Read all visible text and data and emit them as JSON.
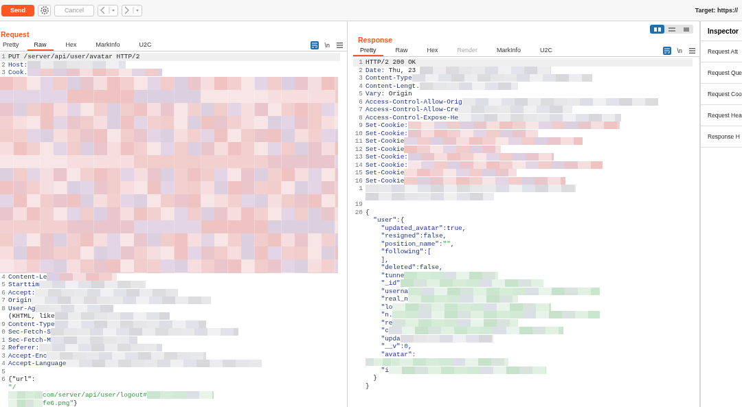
{
  "toolbar": {
    "send": "Send",
    "cancel": "Cancel",
    "cancel_disabled": true,
    "target": "Target: https://"
  },
  "request": {
    "title": "Request",
    "tabs": [
      {
        "label": "Pretty",
        "selected": false,
        "disabled": false
      },
      {
        "label": "Raw",
        "selected": true,
        "disabled": false
      },
      {
        "label": "Hex",
        "selected": false,
        "disabled": false
      },
      {
        "label": "MarkInfo",
        "selected": false,
        "disabled": false
      },
      {
        "label": "U2C",
        "selected": false,
        "disabled": false
      }
    ],
    "newline_toggle": "\\n",
    "lines": [
      {
        "kind": "code",
        "num": "1",
        "current": true,
        "segs": [
          {
            "kind": "plain",
            "text": "PUT /server/api/user/avatar HTTP/2"
          }
        ]
      },
      {
        "kind": "code",
        "num": "2",
        "current": false,
        "mosaic": {
          "kind": "grey"
        },
        "segs": [
          {
            "kind": "key",
            "text": "Host:"
          }
        ]
      },
      {
        "kind": "code",
        "num": "3",
        "current": false,
        "mosaic": {
          "kind": "pink"
        },
        "segs": [
          {
            "kind": "key",
            "text": "Cook."
          }
        ]
      },
      {
        "kind": "block",
        "mosaic": {
          "kind": "pink"
        }
      },
      {
        "kind": "code",
        "num": "4",
        "current": false,
        "mosaic": {
          "kind": "pink"
        },
        "segs": [
          {
            "kind": "key",
            "text": "Content-Le"
          }
        ]
      },
      {
        "kind": "code",
        "num": "5",
        "current": false,
        "mosaic": {
          "kind": "grey"
        },
        "segs": [
          {
            "kind": "key",
            "text": "Starttim"
          }
        ]
      },
      {
        "kind": "code",
        "num": "6",
        "current": false,
        "mosaic": {
          "kind": "grey"
        },
        "segs": [
          {
            "kind": "key",
            "text": "Accept:"
          }
        ]
      },
      {
        "kind": "code",
        "num": "7",
        "current": false,
        "mosaic": {
          "kind": "grey"
        },
        "segs": [
          {
            "kind": "key",
            "text": "Origin"
          }
        ]
      },
      {
        "kind": "code",
        "num": "8",
        "current": false,
        "mosaic": {
          "kind": "grey"
        },
        "segs": [
          {
            "kind": "key",
            "text": "User-Ag"
          }
        ]
      },
      {
        "kind": "code",
        "current": false,
        "mosaic": {
          "kind": "grey"
        },
        "segs": [
          {
            "kind": "plain",
            "text": "(KHTML, like"
          }
        ]
      },
      {
        "kind": "code",
        "num": "9",
        "current": false,
        "mosaic": {
          "kind": "grey"
        },
        "segs": [
          {
            "kind": "key",
            "text": "Content-Type"
          }
        ]
      },
      {
        "kind": "code",
        "num": "0",
        "current": false,
        "mosaic": {
          "kind": "grey"
        },
        "segs": [
          {
            "kind": "key",
            "text": "Sec-Fetch-S"
          }
        ]
      },
      {
        "kind": "code",
        "num": "1",
        "current": false,
        "mosaic": {
          "kind": "grey"
        },
        "segs": [
          {
            "kind": "key",
            "text": "Sec-Fetch-M"
          }
        ]
      },
      {
        "kind": "code",
        "num": "2",
        "current": false,
        "mosaic": {
          "kind": "grey"
        },
        "segs": [
          {
            "kind": "key",
            "text": "Referer:"
          }
        ]
      },
      {
        "kind": "code",
        "num": "3",
        "current": false,
        "mosaic": {
          "kind": "grey"
        },
        "segs": [
          {
            "kind": "key",
            "text": "Accept-Enc"
          }
        ]
      },
      {
        "kind": "code",
        "num": "4",
        "current": false,
        "mosaic": {
          "kind": "grey"
        },
        "segs": [
          {
            "kind": "key",
            "text": "Accept-Language"
          }
        ]
      },
      {
        "kind": "code",
        "num": "5",
        "current": false
      },
      {
        "kind": "code",
        "num": "6",
        "current": false,
        "segs": [
          {
            "kind": "plain",
            "text": "{\"url\":"
          }
        ]
      },
      {
        "kind": "code",
        "current": false,
        "segs": [
          {
            "kind": "string",
            "text": "\"/"
          }
        ]
      },
      {
        "kind": "code",
        "current": false,
        "lead": {
          "kind": "green"
        },
        "mosaic": {
          "kind": "green"
        },
        "segs": [
          {
            "kind": "string",
            "text": "com/server/api/user/logout#"
          }
        ]
      },
      {
        "kind": "code",
        "current": false,
        "lead": {
          "kind": "green"
        },
        "segs": [
          {
            "kind": "string",
            "text": "fe6.png\""
          },
          {
            "kind": "plain",
            "text": "}"
          }
        ]
      }
    ]
  },
  "response": {
    "title": "Response",
    "layout_toggle": [
      {
        "selected": true
      },
      {
        "selected": false
      },
      {
        "selected": false
      }
    ],
    "tabs": [
      {
        "label": "Pretty",
        "selected": true,
        "disabled": false
      },
      {
        "label": "Raw",
        "selected": false,
        "disabled": false
      },
      {
        "label": "Hex",
        "selected": false,
        "disabled": false
      },
      {
        "label": "Render",
        "selected": false,
        "disabled": true
      },
      {
        "label": "MarkInfo",
        "selected": false,
        "disabled": false
      },
      {
        "label": "U2C",
        "selected": false,
        "disabled": false
      }
    ],
    "newline_toggle": "\\n",
    "lines": [
      {
        "kind": "code",
        "num": "1",
        "current": true,
        "segs": [
          {
            "kind": "plain",
            "text": "HTTP/2 200 OK"
          }
        ]
      },
      {
        "kind": "code",
        "num": "2",
        "current": false,
        "mosaic": {
          "kind": "grey"
        },
        "segs": [
          {
            "kind": "key",
            "text": "Date:"
          },
          {
            "kind": "plain",
            "text": " Thu, 23 "
          }
        ]
      },
      {
        "kind": "code",
        "num": "3",
        "current": false,
        "mosaic": {
          "kind": "grey"
        },
        "segs": [
          {
            "kind": "key",
            "text": "Content-Type"
          }
        ]
      },
      {
        "kind": "code",
        "num": "4",
        "current": false,
        "mosaic": {
          "kind": "grey"
        },
        "segs": [
          {
            "kind": "key",
            "text": "Content-Lengt."
          }
        ]
      },
      {
        "kind": "code",
        "num": "5",
        "current": false,
        "segs": [
          {
            "kind": "key",
            "text": "Vary:"
          },
          {
            "kind": "plain",
            "text": " Origin"
          }
        ]
      },
      {
        "kind": "code",
        "num": "6",
        "current": false,
        "mosaic": {
          "kind": "grey"
        },
        "segs": [
          {
            "kind": "key",
            "text": "Access-Control-Allow-Orig"
          }
        ]
      },
      {
        "kind": "code",
        "num": "7",
        "current": false,
        "mosaic": {
          "kind": "grey"
        },
        "segs": [
          {
            "kind": "key",
            "text": "Access-Control-Allow-Cre"
          }
        ]
      },
      {
        "kind": "code",
        "num": "8",
        "current": false,
        "mosaic": {
          "kind": "grey"
        },
        "segs": [
          {
            "kind": "key",
            "text": "Access-Control-Expose-He"
          }
        ]
      },
      {
        "kind": "code",
        "num": "9",
        "current": false,
        "mosaic": {
          "kind": "pink"
        },
        "segs": [
          {
            "kind": "key",
            "text": "Set-Cookie:"
          }
        ]
      },
      {
        "kind": "code",
        "num": "10",
        "current": false,
        "mosaic": {
          "kind": "pink"
        },
        "segs": [
          {
            "kind": "key",
            "text": "Set-Cookie:"
          }
        ]
      },
      {
        "kind": "code",
        "num": "11",
        "current": false,
        "mosaic": {
          "kind": "pink"
        },
        "segs": [
          {
            "kind": "key",
            "text": "Set-Cookie"
          }
        ]
      },
      {
        "kind": "code",
        "num": "12",
        "current": false,
        "mosaic": {
          "kind": "pink"
        },
        "segs": [
          {
            "kind": "key",
            "text": "Set-Cookie"
          }
        ]
      },
      {
        "kind": "code",
        "num": "13",
        "current": false,
        "mosaic": {
          "kind": "pink"
        },
        "segs": [
          {
            "kind": "key",
            "text": "Set-Cookie:"
          }
        ]
      },
      {
        "kind": "code",
        "num": "14",
        "current": false,
        "mosaic": {
          "kind": "pink"
        },
        "segs": [
          {
            "kind": "key",
            "text": "Set-Cookie:"
          }
        ]
      },
      {
        "kind": "code",
        "num": "15",
        "current": false,
        "mosaic": {
          "kind": "pink"
        },
        "segs": [
          {
            "kind": "key",
            "text": "Set-Cookie"
          }
        ]
      },
      {
        "kind": "code",
        "num": "16",
        "current": false,
        "mosaic": {
          "kind": "pink"
        },
        "segs": [
          {
            "kind": "key",
            "text": "Set-Cookie"
          }
        ]
      },
      {
        "kind": "code",
        "num": "1",
        "current": false,
        "mosaic": {
          "kind": "grey"
        }
      },
      {
        "kind": "code",
        "current": false,
        "mosaic": {
          "kind": "grey"
        }
      },
      {
        "kind": "code",
        "num": "19",
        "current": false
      },
      {
        "kind": "code",
        "num": "20",
        "current": false,
        "segs": [
          {
            "kind": "plain",
            "text": "{"
          }
        ]
      },
      {
        "kind": "code",
        "current": false,
        "segs": [
          {
            "kind": "key",
            "text": "  \"user\":"
          },
          {
            "kind": "plain",
            "text": "{"
          }
        ]
      },
      {
        "kind": "code",
        "current": false,
        "segs": [
          {
            "kind": "key",
            "text": "    \"updated_avatar\":true,"
          }
        ]
      },
      {
        "kind": "code",
        "current": false,
        "segs": [
          {
            "kind": "key",
            "text": "    \"resigned\":false,"
          }
        ]
      },
      {
        "kind": "code",
        "current": false,
        "segs": [
          {
            "kind": "key",
            "text": "    \"position_name\":"
          },
          {
            "kind": "string",
            "text": "\"\""
          },
          {
            "kind": "key",
            "text": ","
          }
        ]
      },
      {
        "kind": "code",
        "current": false,
        "segs": [
          {
            "kind": "key",
            "text": "    \"following\":["
          }
        ]
      },
      {
        "kind": "code",
        "current": false,
        "segs": [
          {
            "kind": "key",
            "text": "    ],"
          }
        ]
      },
      {
        "kind": "code",
        "current": false,
        "segs": [
          {
            "kind": "key",
            "text": "    \"deleted\":false,"
          }
        ]
      },
      {
        "kind": "code",
        "current": false,
        "mosaic": {
          "kind": "green"
        },
        "segs": [
          {
            "kind": "key",
            "text": "    \"tunne"
          }
        ]
      },
      {
        "kind": "code",
        "current": false,
        "mosaic": {
          "kind": "green"
        },
        "segs": [
          {
            "kind": "key",
            "text": "    \"_id\""
          }
        ]
      },
      {
        "kind": "code",
        "current": false,
        "mosaic": {
          "kind": "green"
        },
        "segs": [
          {
            "kind": "key",
            "text": "    \"userna"
          }
        ]
      },
      {
        "kind": "code",
        "current": false,
        "mosaic": {
          "kind": "green"
        },
        "segs": [
          {
            "kind": "key",
            "text": "    \"real_n"
          }
        ]
      },
      {
        "kind": "code",
        "current": false,
        "mosaic": {
          "kind": "green"
        },
        "segs": [
          {
            "kind": "key",
            "text": "    \"lo"
          }
        ]
      },
      {
        "kind": "code",
        "current": false,
        "mosaic": {
          "kind": "green"
        },
        "segs": [
          {
            "kind": "key",
            "text": "    \"n."
          }
        ]
      },
      {
        "kind": "code",
        "current": false,
        "mosaic": {
          "kind": "green"
        },
        "segs": [
          {
            "kind": "key",
            "text": "    \"re"
          }
        ]
      },
      {
        "kind": "code",
        "current": false,
        "mosaic": {
          "kind": "green"
        },
        "segs": [
          {
            "kind": "key",
            "text": "    \"c"
          }
        ]
      },
      {
        "kind": "code",
        "current": false,
        "mosaic": {
          "kind": "grey"
        },
        "segs": [
          {
            "kind": "key",
            "text": "    \"upda"
          }
        ]
      },
      {
        "kind": "code",
        "current": false,
        "segs": [
          {
            "kind": "key",
            "text": "    \"__v\":"
          },
          {
            "kind": "number",
            "text": "0"
          },
          {
            "kind": "key",
            "text": ","
          }
        ]
      },
      {
        "kind": "code",
        "current": false,
        "segs": [
          {
            "kind": "key",
            "text": "    \"avatar\":"
          }
        ]
      },
      {
        "kind": "code",
        "current": false,
        "lead": {
          "kind": "green"
        },
        "mosaic": {
          "kind": "green"
        }
      },
      {
        "kind": "code",
        "current": false,
        "mosaic": {
          "kind": "green"
        },
        "segs": [
          {
            "kind": "key",
            "text": "    \"i"
          }
        ]
      },
      {
        "kind": "code",
        "current": false,
        "segs": [
          {
            "kind": "plain",
            "text": "  }"
          }
        ]
      },
      {
        "kind": "code",
        "current": false,
        "segs": [
          {
            "kind": "plain",
            "text": "}"
          }
        ]
      }
    ]
  },
  "inspector": {
    "title": "Inspector",
    "items": [
      "Request Att",
      "Request Que",
      "Request Coo",
      "Request Hea",
      "Response H"
    ]
  }
}
